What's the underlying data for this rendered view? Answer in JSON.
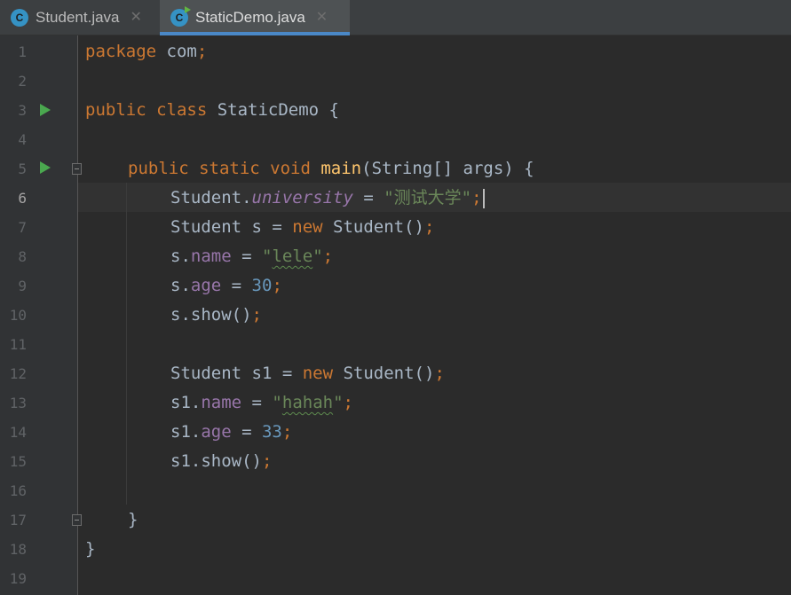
{
  "tabs": [
    {
      "label": "Student.java",
      "icon": "java-class-icon",
      "active": false
    },
    {
      "label": "StaticDemo.java",
      "icon": "java-class-runnable-icon",
      "active": true
    }
  ],
  "colors": {
    "background": "#2b2b2b",
    "gutter": "#313335",
    "keyword": "#cc7832",
    "string": "#6a8759",
    "number": "#6897bb",
    "field": "#9876aa",
    "method": "#ffc66d",
    "text": "#a9b7c6",
    "tab_accent": "#4a88c7"
  },
  "editor": {
    "current_line": 6,
    "line_numbers": [
      "1",
      "2",
      "3",
      "4",
      "5",
      "6",
      "7",
      "8",
      "9",
      "10",
      "11",
      "12",
      "13",
      "14",
      "15",
      "16",
      "17",
      "18",
      "19"
    ],
    "lines": {
      "l1": {
        "kw": "package",
        "rest": " com",
        "semi": ";"
      },
      "l3": {
        "kw": "public class",
        "rest": " StaticDemo {"
      },
      "l5": {
        "kw": "public static void",
        "method": "main",
        "rest": "(String[] args) {"
      },
      "l6": {
        "cls": "Student.",
        "field": "university",
        "eq": " = ",
        "str": "\"测试大学\"",
        "semi": ";"
      },
      "l7": {
        "pre": "Student s = ",
        "kw": "new",
        "rest": " Student()",
        "semi": ";"
      },
      "l8": {
        "pre": "s.",
        "field": "name",
        "eq": " = ",
        "q1": "\"",
        "strtypo": "lele",
        "q2": "\"",
        "semi": ";"
      },
      "l9": {
        "pre": "s.",
        "field": "age",
        "eq": " = ",
        "num": "30",
        "semi": ";"
      },
      "l10": {
        "pre": "s.show()",
        "semi": ";"
      },
      "l12": {
        "pre": "Student s1 = ",
        "kw": "new",
        "rest": " Student()",
        "semi": ";"
      },
      "l13": {
        "pre": "s1.",
        "field": "name",
        "eq": " = ",
        "q1": "\"",
        "strtypo": "hahah",
        "q2": "\"",
        "semi": ";"
      },
      "l14": {
        "pre": "s1.",
        "field": "age",
        "eq": " = ",
        "num": "33",
        "semi": ";"
      },
      "l15": {
        "pre": "s1.show()",
        "semi": ";"
      },
      "l17": {
        "brace": "}"
      },
      "l18": {
        "brace": "}"
      }
    }
  }
}
